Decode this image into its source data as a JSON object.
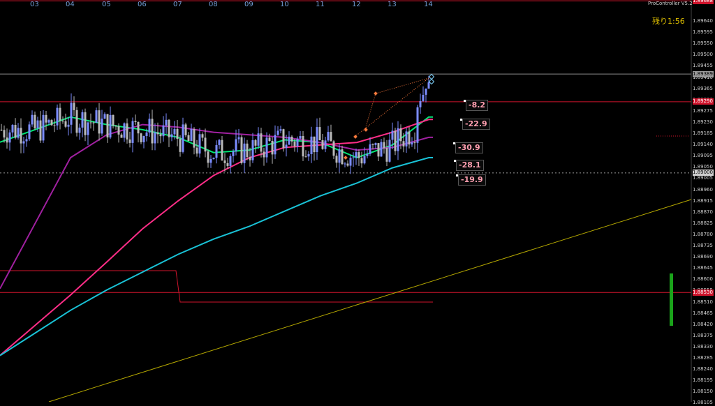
{
  "chart_data": {
    "type": "candlestick",
    "x_labels": [
      "03",
      "04",
      "05",
      "06",
      "07",
      "08",
      "09",
      "10",
      "11",
      "12",
      "13",
      "14"
    ],
    "y_ticks": [
      "1.89640",
      "1.89595",
      "1.89550",
      "1.89500",
      "1.89455",
      "1.89410",
      "1.89365",
      "1.89320",
      "1.89275",
      "1.89230",
      "1.89185",
      "1.89140",
      "1.89095",
      "1.89050",
      "1.89005",
      "1.88960",
      "1.88915",
      "1.88870",
      "1.88825",
      "1.88780",
      "1.88735",
      "1.88690",
      "1.88645",
      "1.88600",
      "1.88555",
      "1.88510",
      "1.88465",
      "1.88420",
      "1.88375",
      "1.88330",
      "1.88285",
      "1.88240",
      "1.88195",
      "1.88150",
      "1.88105"
    ],
    "ylim": [
      1.881,
      1.8968
    ],
    "price_labels": {
      "top_red": "1.89688",
      "current": "1.89389",
      "red_level": "1.89290",
      "dashed_level": "1.89000",
      "lower_red": "1.88530"
    },
    "levels": {
      "top_red": 1.89677,
      "current": 1.89389,
      "red_level": 1.8928,
      "dashed_level": 1.89,
      "lower_red": 1.8853
    },
    "moving_averages": [
      {
        "color": "#00e676",
        "values": [
          1.8917,
          1.8922,
          1.8919,
          1.8917,
          1.8914,
          1.8908,
          1.8909,
          1.8913,
          1.8912,
          1.8906,
          1.8911,
          1.8922
        ]
      },
      {
        "color": "#a020a0",
        "values": [
          1.888,
          1.8906,
          1.8915,
          1.8919,
          1.8918,
          1.8916,
          1.8915,
          1.8914,
          1.8912,
          1.8909,
          1.891,
          1.8914
        ]
      },
      {
        "color": "#ff2d87",
        "values": [
          1.884,
          1.8852,
          1.8865,
          1.8878,
          1.8889,
          1.8899,
          1.8906,
          1.891,
          1.8911,
          1.8912,
          1.8916,
          1.8921
        ]
      },
      {
        "color": "#19c2d6",
        "values": [
          1.8837,
          1.8846,
          1.8854,
          1.8861,
          1.8868,
          1.8874,
          1.8879,
          1.8885,
          1.8891,
          1.8896,
          1.8902,
          1.8906
        ]
      }
    ],
    "deviation_labels": [
      "-8.2",
      "-22.9",
      "-30.9",
      "-28.1",
      "-19.9"
    ],
    "timer_text": "残り1:56",
    "indicator_name": "ProController V5.2"
  },
  "colors": {
    "background": "#000000",
    "bull_candle": "#7b8cff",
    "bear_candle": "#b9b9b9",
    "level_red": "#d0142c",
    "trendline": "#b5a800",
    "volume_bar": "#1aa31a"
  }
}
